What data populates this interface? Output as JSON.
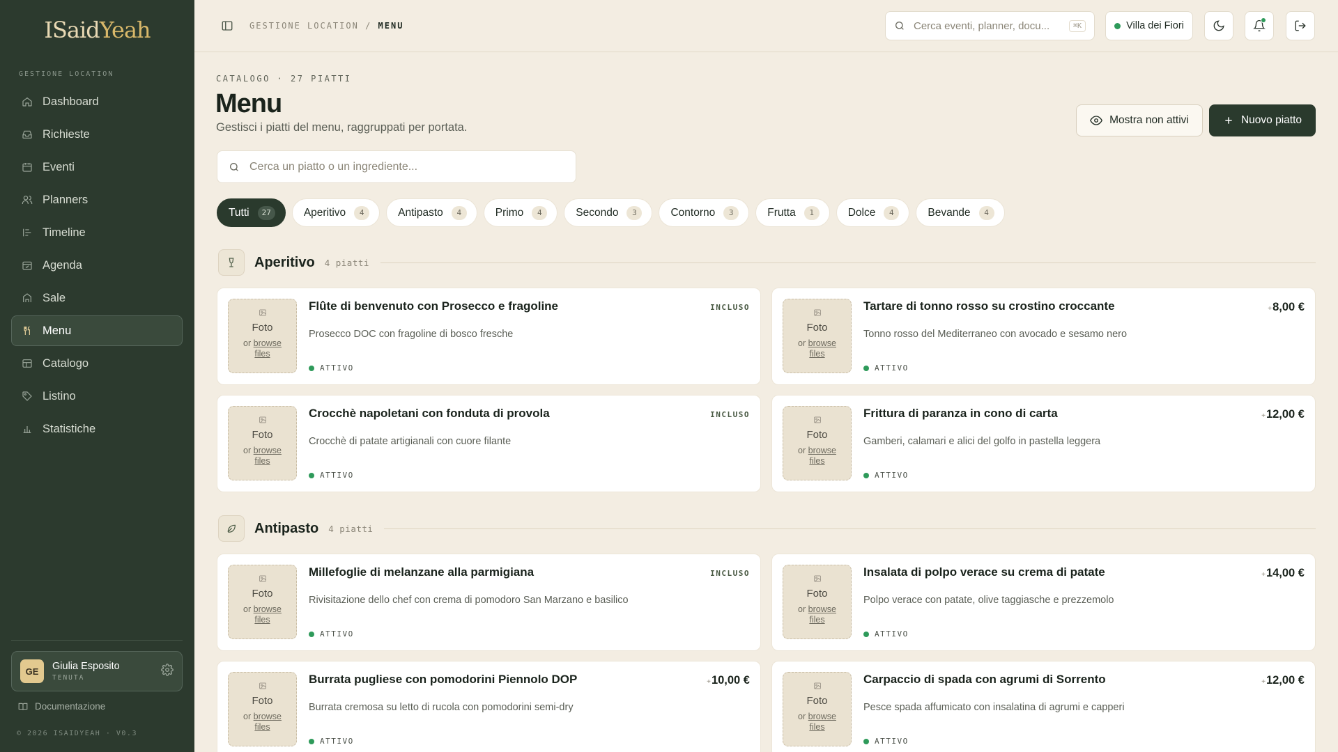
{
  "app": {
    "logo": {
      "part1": "ISaid",
      "part2": "Yeah"
    },
    "brand_color": "#2c3a2e",
    "accent_color": "#e2c98f",
    "status_color": "#2e9a5a"
  },
  "sidebar": {
    "section_label": "GESTIONE LOCATION",
    "items": [
      {
        "label": "Dashboard",
        "icon": "home-icon"
      },
      {
        "label": "Richieste",
        "icon": "inbox-icon"
      },
      {
        "label": "Eventi",
        "icon": "calendar-icon"
      },
      {
        "label": "Planners",
        "icon": "users-icon"
      },
      {
        "label": "Timeline",
        "icon": "timeline-icon"
      },
      {
        "label": "Agenda",
        "icon": "agenda-icon"
      },
      {
        "label": "Sale",
        "icon": "building-icon"
      },
      {
        "label": "Menu",
        "icon": "utensils-icon",
        "active": true
      },
      {
        "label": "Catalogo",
        "icon": "grid-icon"
      },
      {
        "label": "Listino",
        "icon": "tag-icon"
      },
      {
        "label": "Statistiche",
        "icon": "bar-chart-icon"
      }
    ],
    "user": {
      "initials": "GE",
      "name": "Giulia Esposito",
      "role": "TENUTA"
    },
    "docs_label": "Documentazione",
    "copyright": "© 2026 ISAIDYEAH · V0.3"
  },
  "topbar": {
    "breadcrumb": {
      "parent": "GESTIONE LOCATION",
      "separator": "/",
      "current": "MENU"
    },
    "search_placeholder": "Cerca eventi, planner, docu...",
    "search_shortcut": "⌘K",
    "venue": "Villa dei Fiori"
  },
  "header": {
    "kicker": "CATALOGO · 27 PIATTI",
    "title": "Menu",
    "subtitle": "Gestisci i piatti del menu, raggruppati per portata.",
    "show_inactive_label": "Mostra non attivi",
    "new_dish_label": "Nuovo piatto",
    "dish_search_placeholder": "Cerca un piatto o un ingrediente..."
  },
  "filters": [
    {
      "label": "Tutti",
      "count": "27",
      "active": true
    },
    {
      "label": "Aperitivo",
      "count": "4"
    },
    {
      "label": "Antipasto",
      "count": "4"
    },
    {
      "label": "Primo",
      "count": "4"
    },
    {
      "label": "Secondo",
      "count": "3"
    },
    {
      "label": "Contorno",
      "count": "3"
    },
    {
      "label": "Frutta",
      "count": "1"
    },
    {
      "label": "Dolce",
      "count": "4"
    },
    {
      "label": "Bevande",
      "count": "4"
    }
  ],
  "photo_placeholder": {
    "label": "Foto",
    "or": "or",
    "browse": "browse",
    "files": "files"
  },
  "sections": [
    {
      "title": "Aperitivo",
      "count": "4 piatti",
      "icon": "glass-icon",
      "dishes": [
        {
          "name": "Flûte di benvenuto con Prosecco e fragoline",
          "desc": "Prosecco DOC con fragoline di bosco fresche",
          "price": "INCLUSO",
          "status": "ATTIVO"
        },
        {
          "name": "Tartare di tonno rosso su crostino croccante",
          "desc": "Tonno rosso del Mediterraneo con avocado e sesamo nero",
          "price": "8,00 €",
          "status": "ATTIVO"
        },
        {
          "name": "Crocchè napoletani con fonduta di provola",
          "desc": "Crocchè di patate artigianali con cuore filante",
          "price": "INCLUSO",
          "status": "ATTIVO"
        },
        {
          "name": "Frittura di paranza in cono di carta",
          "desc": "Gamberi, calamari e alici del golfo in pastella leggera",
          "price": "12,00 €",
          "status": "ATTIVO"
        }
      ]
    },
    {
      "title": "Antipasto",
      "count": "4 piatti",
      "icon": "leaf-icon",
      "dishes": [
        {
          "name": "Millefoglie di melanzane alla parmigiana",
          "desc": "Rivisitazione dello chef con crema di pomodoro San Marzano e basilico",
          "price": "INCLUSO",
          "status": "ATTIVO"
        },
        {
          "name": "Insalata di polpo verace su crema di patate",
          "desc": "Polpo verace con patate, olive taggiasche e prezzemolo",
          "price": "14,00 €",
          "status": "ATTIVO"
        },
        {
          "name": "Burrata pugliese con pomodorini Piennolo DOP",
          "desc": "Burrata cremosa su letto di rucola con pomodorini semi-dry",
          "price": "10,00 €",
          "status": "ATTIVO"
        },
        {
          "name": "Carpaccio di spada con agrumi di Sorrento",
          "desc": "Pesce spada affumicato con insalatina di agrumi e capperi",
          "price": "12,00 €",
          "status": "ATTIVO"
        }
      ]
    }
  ]
}
